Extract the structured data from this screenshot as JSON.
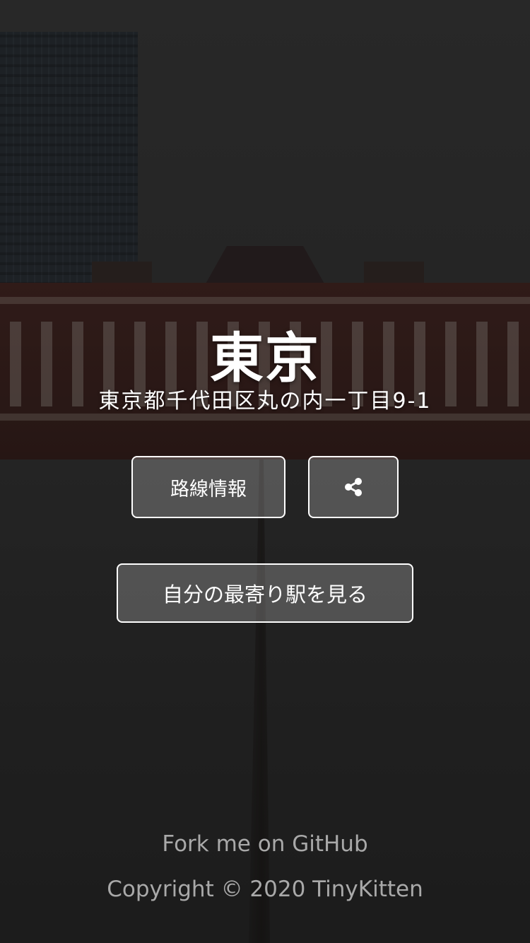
{
  "station": {
    "name": "東京",
    "address": "東京都千代田区丸の内一丁目9-1"
  },
  "actions": {
    "route_label": "路線情報",
    "share_icon": "share-icon",
    "nearest_label": "自分の最寄り駅を見る"
  },
  "footer": {
    "github_label": "Fork me on GitHub",
    "copyright": "Copyright © 2020 TinyKitten"
  }
}
